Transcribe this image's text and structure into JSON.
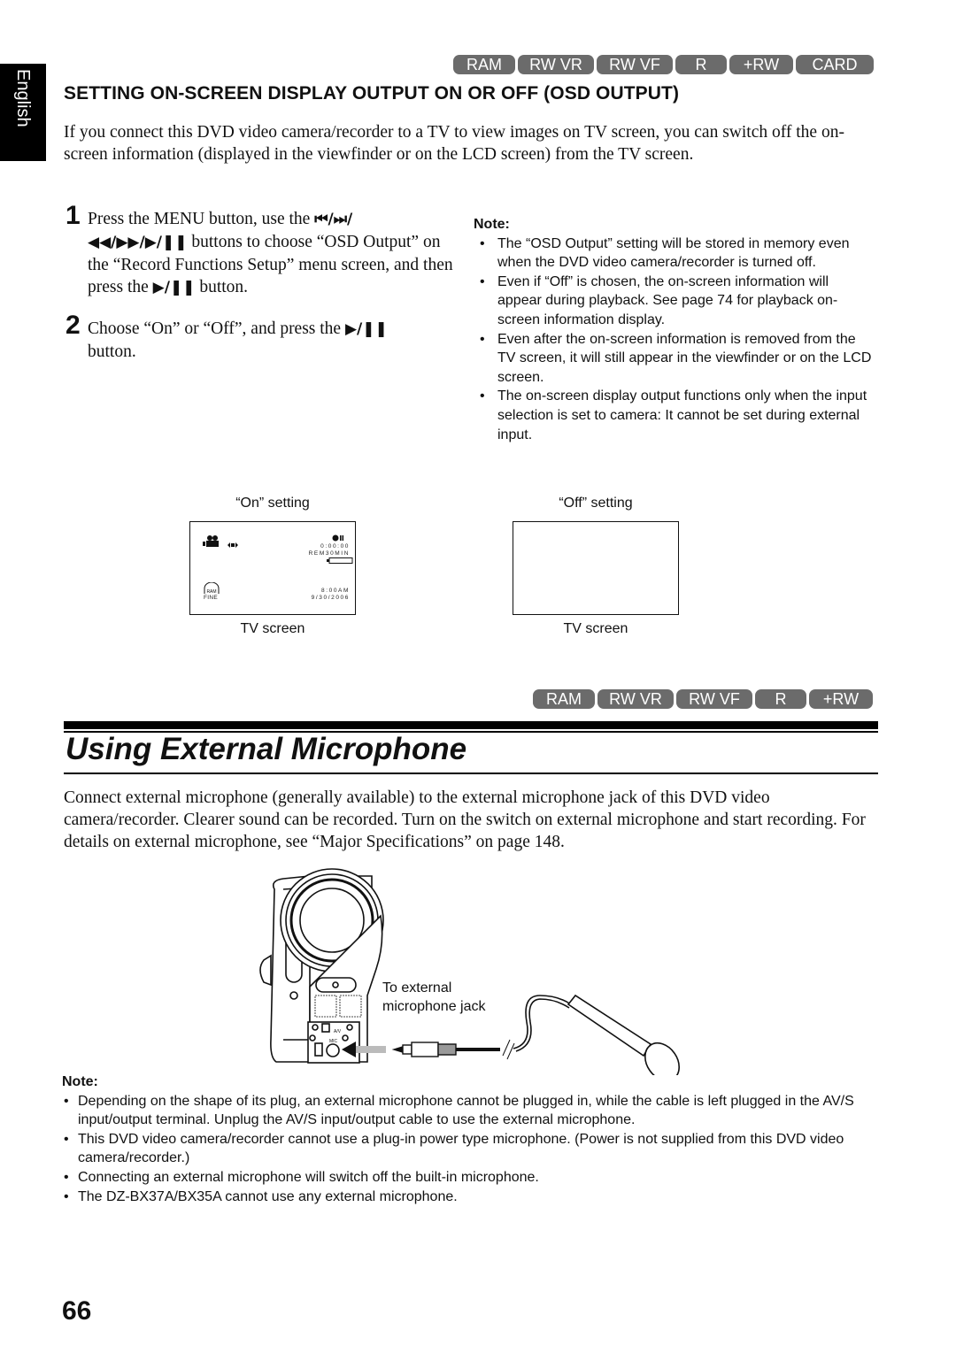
{
  "side_tab": {
    "language": "English"
  },
  "top_badges": [
    "RAM",
    "RW VR",
    "RW VF",
    "R",
    "+RW",
    "CARD"
  ],
  "osd_section": {
    "heading": "SETTING ON-SCREEN DISPLAY OUTPUT ON OR OFF (OSD OUTPUT)",
    "intro": "If you connect this DVD video camera/recorder to a TV to view images on TV screen, you can switch off the on-screen information (displayed in the viewfinder or on the LCD screen) from the TV screen.",
    "steps": [
      {
        "number": "1",
        "text_a": "Press the MENU button, use the ",
        "icons_a": "⏮/⏭/",
        "icons_b": "◀◀/▶▶/▶/❚❚",
        "text_b": " buttons to choose “OSD Output” on the “Record Functions Setup” menu screen, and then press the ",
        "icons_c": "▶/❚❚",
        "text_c": " button."
      },
      {
        "number": "2",
        "text_a": "Choose “On” or “Off”, and press the ",
        "icons_a": "▶/❚❚",
        "text_b": " button."
      }
    ],
    "note": {
      "title": "Note:",
      "items": [
        "The “OSD Output” setting will be stored in memory even when the DVD video camera/recorder is turned off.",
        "Even if “Off” is chosen, the on-screen information will appear during playback. See page 74 for playback on-screen information display.",
        "Even after the on-screen information is removed from the TV screen, it will still appear in the viewfinder or on the LCD screen.",
        "The on-screen display output functions only when the input selection is set to camera: It cannot be set during external input."
      ]
    },
    "figures": {
      "on": {
        "caption": "“On” setting",
        "screen_label": "TV screen",
        "osd": {
          "timecode": "0:00:00",
          "remaining": "REM30MIN",
          "quality": "FINE",
          "disc": "RAM",
          "time": "8:00AM",
          "date": "9/30/2006"
        }
      },
      "off": {
        "caption": "“Off” setting",
        "screen_label": "TV screen"
      }
    }
  },
  "mid_badges": [
    "RAM",
    "RW VR",
    "RW VF",
    "R",
    "+RW"
  ],
  "mic_section": {
    "title": "Using External Microphone",
    "body": "Connect external microphone (generally available) to the external microphone jack of this DVD video camera/recorder. Clearer sound can be recorded. Turn on the switch on external microphone and start recording. For details on external microphone, see “Major Specifications” on page 148.",
    "illustration_label_line1": "To external",
    "illustration_label_line2": "microphone jack",
    "jack_labels": {
      "av": "A/V",
      "mic": "MIC"
    },
    "note": {
      "title": "Note:",
      "items": [
        "Depending on the shape of its plug, an external microphone cannot be plugged in, while the cable is left plugged in the AV/S input/output terminal. Unplug the AV/S input/output cable to use the external microphone.",
        "This DVD video camera/recorder cannot use a plug-in power type microphone. (Power is not supplied from this DVD video camera/recorder.)",
        "Connecting an external microphone will switch off the built-in microphone.",
        "The DZ-BX37A/BX35A cannot use any external microphone."
      ]
    }
  },
  "page_number": "66"
}
